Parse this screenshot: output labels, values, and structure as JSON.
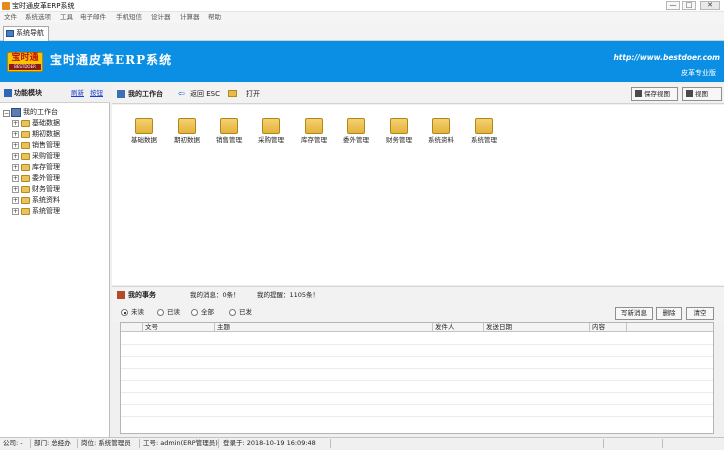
{
  "window": {
    "title": "宝时通皮革ERP系统",
    "min": "—",
    "max": "□",
    "close": "✕"
  },
  "menu": [
    "文件",
    "系统选项",
    "工具",
    "电子邮件",
    "手机短信",
    "设计器",
    "计算器",
    "帮助"
  ],
  "tab": {
    "label": "系统导航"
  },
  "banner": {
    "logo_text": "宝时通",
    "logo_sub": "BESTDOER",
    "title": "宝时通皮革ERP系统",
    "url": "http://www.bestdoer.com",
    "edition": "皮革专业版",
    "color": "#0a8fe4"
  },
  "left_panel": {
    "title": "功能模块",
    "refresh": "刷新",
    "collapse": "按钮",
    "tree_root": "我的工作台",
    "tree_items": [
      "基础数据",
      "期初数据",
      "销售管理",
      "采购管理",
      "库存管理",
      "委外管理",
      "财务管理",
      "系统资料",
      "系统管理"
    ]
  },
  "workbench": {
    "title": "我的工作台",
    "back": "返回 ESC",
    "open": "打开",
    "save_view": "保存视图",
    "view": "视图",
    "modules": [
      "基础数据",
      "期初数据",
      "销售管理",
      "采购管理",
      "库存管理",
      "委外管理",
      "财务管理",
      "系统资料",
      "系统管理"
    ]
  },
  "tasks": {
    "title": "我的事务",
    "messages": "我的消息：0条！",
    "reminders": "我的提醒：1105条！",
    "filters": [
      "未读",
      "已读",
      "全部",
      "已发"
    ],
    "selected_filter": "未读",
    "buttons": {
      "write": "写新消息",
      "delete": "删除",
      "clear": "清空"
    },
    "columns": [
      "文号",
      "主题",
      "发件人",
      "发送日期",
      "内容"
    ]
  },
  "status": {
    "company": "公司: -",
    "department": "部门: 总经办",
    "position": "岗位: 系统管理员",
    "employee": "工号: admin(ERP管理员)",
    "login": "登录于: 2018-10-19 16:09:48"
  }
}
